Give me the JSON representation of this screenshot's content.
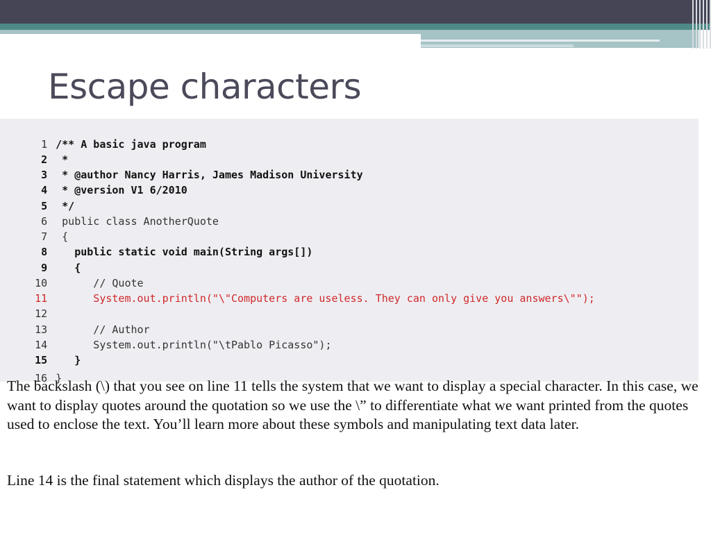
{
  "slide": {
    "title": "Escape characters",
    "colors": {
      "header_dark": "#454555",
      "header_teal": "#4f8a88",
      "header_light": "#a6c3c5",
      "code_background": "#eeeef2",
      "highlight_red": "#d0282a"
    }
  },
  "code": {
    "lines": [
      {
        "num": "1",
        "text": "/** A basic java program"
      },
      {
        "num": "2",
        "text": " *"
      },
      {
        "num": "3",
        "text": " * @author Nancy Harris, James Madison University"
      },
      {
        "num": "4",
        "text": " * @version V1 6/2010"
      },
      {
        "num": "5",
        "text": " */"
      },
      {
        "num": "6",
        "text": " public class AnotherQuote"
      },
      {
        "num": "7",
        "text": " {"
      },
      {
        "num": "8",
        "text": "   public static void main(String args[])"
      },
      {
        "num": "9",
        "text": "   {"
      },
      {
        "num": "10",
        "text": "      // Quote"
      },
      {
        "num": "11",
        "text": "      System.out.println(\"\\\"Computers are useless. They can only give you answers\\\"\");"
      },
      {
        "num": "12",
        "text": ""
      },
      {
        "num": "13",
        "text": "      // Author"
      },
      {
        "num": "14",
        "text": "      System.out.println(\"\\tPablo Picasso\");"
      },
      {
        "num": "15",
        "text": "   }"
      },
      {
        "num": "16",
        "text": "}"
      }
    ]
  },
  "description": {
    "paragraph1": "The backslash (\\) that you see on line 11 tells the system that we want to display a special character. In this case, we want to display quotes around the quotation so we use the \\” to differentiate what we want printed from the quotes used to enclose the text.  You’ll learn more about these symbols and manipulating text data later.",
    "paragraph2": "Line 14 is the final statement which displays the author of the quotation."
  }
}
